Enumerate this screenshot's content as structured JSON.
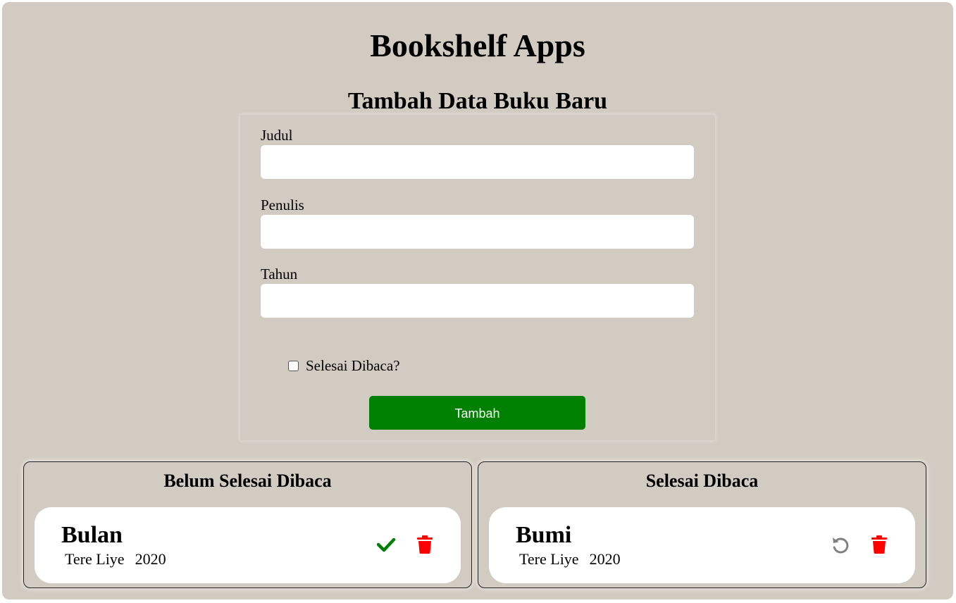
{
  "app": {
    "title": "Bookshelf Apps"
  },
  "form": {
    "heading": "Tambah Data Buku Baru",
    "fields": [
      {
        "label": "Judul",
        "value": "",
        "placeholder": ""
      },
      {
        "label": "Penulis",
        "value": "",
        "placeholder": ""
      },
      {
        "label": "Tahun",
        "value": "",
        "placeholder": ""
      }
    ],
    "checkbox_label": "Selesai Dibaca?",
    "checkbox_checked": false,
    "submit_label": "Tambah"
  },
  "shelves": {
    "unread": {
      "title": "Belum Selesai Dibaca",
      "books": [
        {
          "title": "Bulan",
          "author": "Tere Liye",
          "year": "2020",
          "actions": [
            "check-icon",
            "trash-icon"
          ]
        }
      ]
    },
    "read": {
      "title": "Selesai Dibaca",
      "books": [
        {
          "title": "Bumi",
          "author": "Tere Liye",
          "year": "2020",
          "actions": [
            "undo-icon",
            "trash-icon"
          ]
        }
      ]
    }
  },
  "colors": {
    "background": "#d2cbc1",
    "submit_button": "#008000",
    "check_icon": "#008000",
    "trash_icon": "#ff0000",
    "undo_icon": "#808080"
  }
}
